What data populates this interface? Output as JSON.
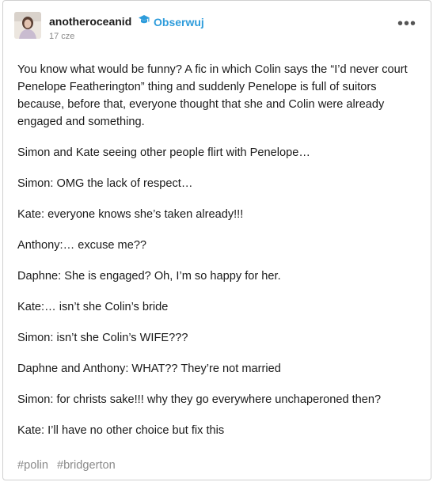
{
  "post": {
    "username": "anotheroceanid",
    "follow_label": "Obserwuj",
    "timestamp": "17 cze",
    "more_label": "•••",
    "paragraphs": [
      "You know what would be funny? A fic in which Colin says the “I’d never court Penelope Featherington” thing and suddenly Penelope is full of suitors because, before that, everyone thought that she and Colin were already engaged and something.",
      "Simon and Kate seeing other people flirt with Penelope…",
      "Simon: OMG the lack of respect…",
      "Kate: everyone knows she’s taken already!!!",
      "Anthony:… excuse me??",
      "Daphne: She is engaged? Oh, I’m so happy for her.",
      "Kate:… isn’t she Colin’s bride",
      "Simon: isn’t she Colin’s WIFE???",
      "Daphne and Anthony: WHAT?? They’re not married",
      "Simon: for christs sake!!! why they go everywhere unchaperoned then?",
      "Kate: I’ll have no other choice but fix this"
    ],
    "tags": [
      "#polin",
      "#bridgerton"
    ]
  },
  "colors": {
    "follow": "#2e9cdb",
    "text": "#1a1a1a",
    "muted": "#8a8a8a"
  },
  "icons": {
    "badge": "graduation-cap-icon",
    "menu": "more-options-icon"
  }
}
